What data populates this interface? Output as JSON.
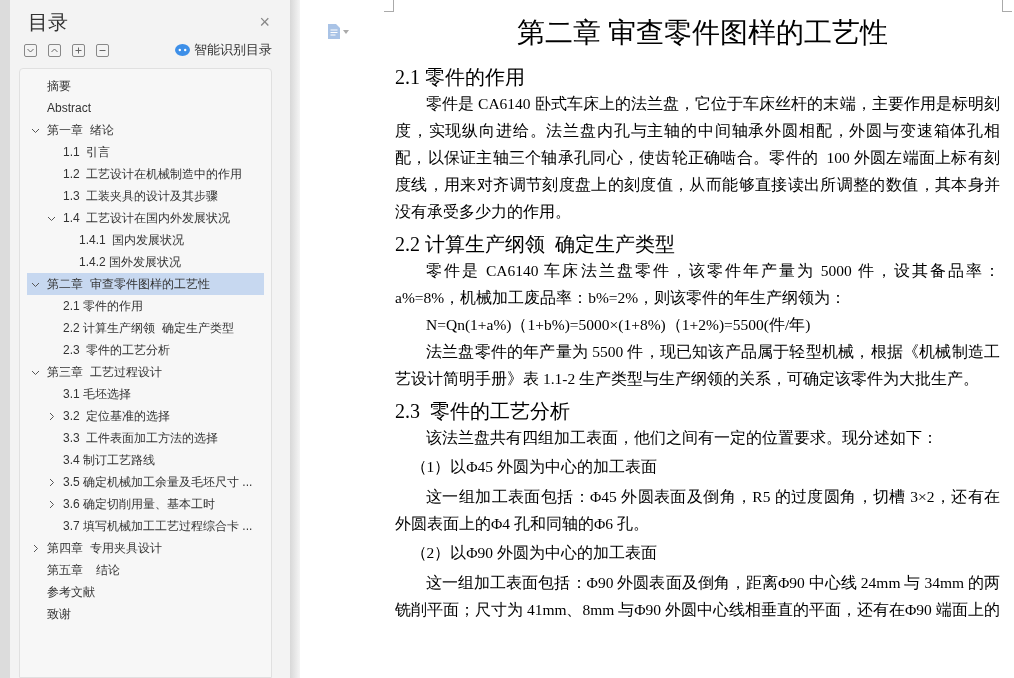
{
  "toc_panel": {
    "title": "目录",
    "close": "×",
    "smart_toc": "智能识别目录",
    "items": [
      {
        "label": "摘要"
      },
      {
        "label": "Abstract"
      },
      {
        "label": "第一章  绪论",
        "expanded": true,
        "selected": false,
        "children": [
          {
            "label": "1.1  引言"
          },
          {
            "label": "1.2  工艺设计在机械制造中的作用"
          },
          {
            "label": "1.3  工装夹具的设计及其步骤"
          },
          {
            "label": "1.4  工艺设计在国内外发展状况",
            "expanded": true,
            "children": [
              {
                "label": "1.4.1  国内发展状况"
              },
              {
                "label": "1.4.2 国外发展状况"
              }
            ]
          }
        ]
      },
      {
        "label": "第二章  审查零件图样的工艺性",
        "expanded": true,
        "selected": true,
        "children": [
          {
            "label": "2.1 零件的作用"
          },
          {
            "label": "2.2 计算生产纲领  确定生产类型"
          },
          {
            "label": "2.3  零件的工艺分析"
          }
        ]
      },
      {
        "label": "第三章  工艺过程设计",
        "expanded": true,
        "children": [
          {
            "label": "3.1 毛坯选择"
          },
          {
            "label": "3.2  定位基准的选择",
            "expanded": false
          },
          {
            "label": "3.3  工件表面加工方法的选择"
          },
          {
            "label": "3.4 制订工艺路线"
          },
          {
            "label": "3.5 确定机械加工余量及毛坯尺寸 ...",
            "expanded": false
          },
          {
            "label": "3.6 确定切削用量、基本工时",
            "expanded": false
          },
          {
            "label": "3.7 填写机械加工工艺过程综合卡 ..."
          }
        ]
      },
      {
        "label": "第四章  专用夹具设计",
        "expanded": false
      },
      {
        "label": "第五章    结论"
      },
      {
        "label": "参考文献"
      },
      {
        "label": "致谢"
      }
    ]
  },
  "document": {
    "title": "第二章  审查零件图样的工艺性",
    "blocks": [
      {
        "kind": "heading",
        "text": "2.1 零件的作用"
      },
      {
        "kind": "para",
        "text": "零件是 CA6140 卧式车床上的法兰盘，它位于车床丝杆的末端，主要作用是标明刻度，实现纵向进给。法兰盘内孔与主轴的中间轴承外圆相配，外圆与变速箱体孔相配，以保证主轴三个轴承孔同心，使齿轮正确啮合。零件的  100 外圆左端面上标有刻度线，用来对齐调节刻度盘上的刻度值，从而能够直接读出所调整的数值，其本身并没有承受多少力的作用。"
      },
      {
        "kind": "heading",
        "text": "2.2 计算生产纲领  确定生产类型"
      },
      {
        "kind": "para",
        "text": "零件是 CA6140 车床法兰盘零件，该零件年产量为 5000 件，设其备品率：a%=8%，机械加工废品率：b%=2%，则该零件的年生产纲领为："
      },
      {
        "kind": "formula",
        "text": "N=Qn(1+a%)（1+b%)=5000×(1+8%)（1+2%)=5500(件/年)"
      },
      {
        "kind": "para",
        "text": "法兰盘零件的年产量为 5500 件，现已知该产品属于轻型机械，根据《机械制造工艺设计简明手册》表 1.1-2 生产类型与生产纲领的关系，可确定该零件为大批生产。"
      },
      {
        "kind": "heading",
        "text": "2.3  零件的工艺分析"
      },
      {
        "kind": "para",
        "text": "该法兰盘共有四组加工表面，他们之间有一定的位置要求。现分述如下："
      },
      {
        "kind": "item",
        "text": "（1）以Φ45 外圆为中心的加工表面"
      },
      {
        "kind": "para",
        "text": "这一组加工表面包括：Φ45 外圆表面及倒角，R5 的过度圆角，切槽 3×2，还有在外圆表面上的Φ4 孔和同轴的Φ6 孔。"
      },
      {
        "kind": "item",
        "text": "（2）以Φ90 外圆为中心的加工表面"
      },
      {
        "kind": "para",
        "text": "这一组加工表面包括：Φ90 外圆表面及倒角，距离Φ90 中心线 24mm 与 34mm 的两铣削平面；尺寸为 41mm、8mm 与Φ90 外圆中心线相垂直的平面，还有在Φ90 端面上的"
      }
    ]
  }
}
